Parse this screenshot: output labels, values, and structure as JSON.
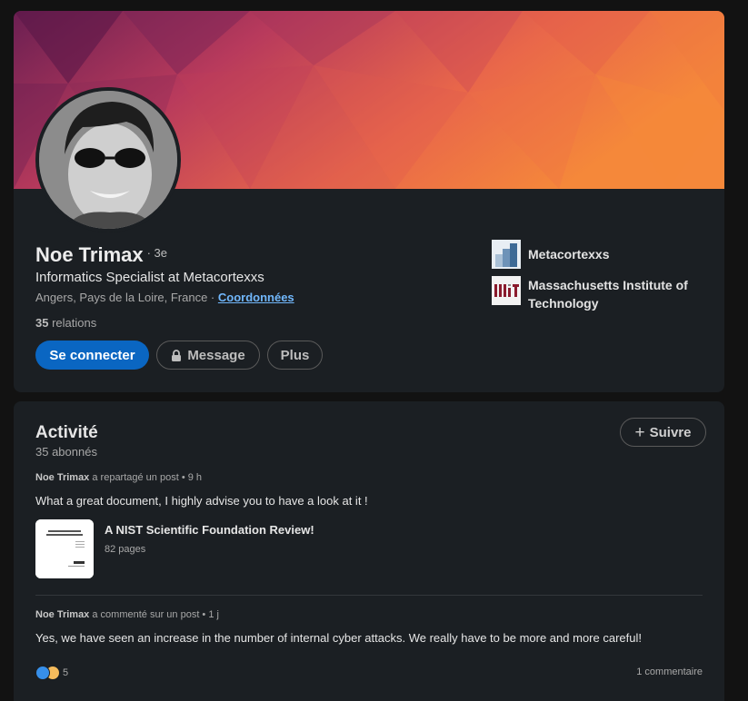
{
  "profile": {
    "name": "Noe Trimax",
    "degree": "· 3e",
    "headline": "Informatics Specialist at Metacortexxs",
    "location": "Angers, Pays de la Loire, France · ",
    "contact_link": "Coordonnées",
    "relations_count": "35",
    "relations_label": " relations"
  },
  "actions": {
    "connect": "Se connecter",
    "message": "Message",
    "more": "Plus"
  },
  "orgs": [
    {
      "name": "Metacortexxs",
      "icon": "metacortexxs-logo"
    },
    {
      "name": "Massachusetts Institute of Technology",
      "icon": "mit-logo"
    }
  ],
  "activity": {
    "title": "Activité",
    "followers": "35 abonnés",
    "follow_button": "Suivre",
    "posts": [
      {
        "author": "Noe Trimax",
        "action": " a repartagé un post • 9 h",
        "text": "What a great document, I highly advise you to have a look at it !",
        "doc_title": "A NIST Scientific Foundation Review!",
        "doc_pages": "82 pages"
      },
      {
        "author": "Noe Trimax",
        "action": " a commenté sur un post • 1 j",
        "text": "Yes, we have seen an increase in the number of internal cyber attacks. We really have to be more and more careful!",
        "reactions": "5",
        "comments": "1 commentaire"
      }
    ]
  },
  "colors": {
    "background": "#121212",
    "card": "#1b1f23",
    "accent": "#0a66c2",
    "link": "#71b7fb"
  }
}
